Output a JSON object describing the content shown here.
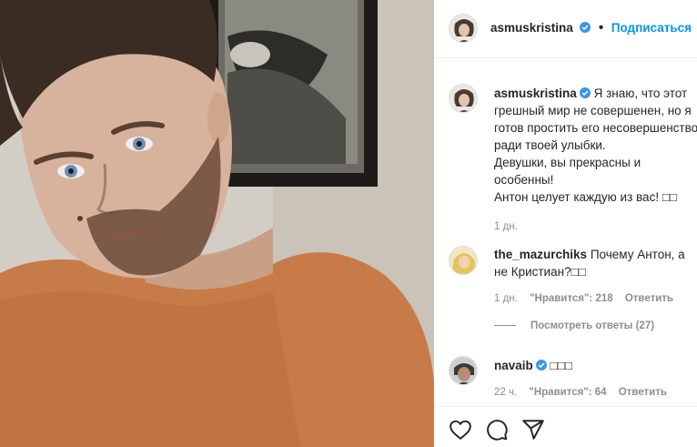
{
  "header": {
    "username": "asmuskristina",
    "follow_label": "Подписаться",
    "separator": "•"
  },
  "caption": {
    "username": "asmuskristina",
    "lines": [
      "Я знаю, что этот",
      "грешный мир не совершенен, но я",
      "готов простить его несовершенство",
      "ради твоей улыбки.",
      "Девушки, вы прекрасны и",
      "особенны!",
      "Антон целует каждую из вас! □□"
    ],
    "time": "1 дн."
  },
  "comments": [
    {
      "username": "the_mazurchiks",
      "lines": [
        "Почему Антон, а",
        "не Кристиан?□□"
      ],
      "time": "1 дн.",
      "likes": "\"Нравится\": 218",
      "reply": "Ответить"
    },
    {
      "username": "navaib",
      "verified": true,
      "lines": [
        "□□□"
      ],
      "time": "22 ч.",
      "likes": "\"Нравится\": 64",
      "reply": "Ответить"
    }
  ],
  "view_replies": "Посмотреть ответы (27)",
  "icons": {
    "like": "heart-icon",
    "comment": "comment-icon",
    "share": "share-icon",
    "verified": "verified-badge-icon"
  },
  "colors": {
    "accent": "#0095f6",
    "muted": "#8e8e8e",
    "text": "#262626",
    "shirt": "#c87a4a"
  }
}
